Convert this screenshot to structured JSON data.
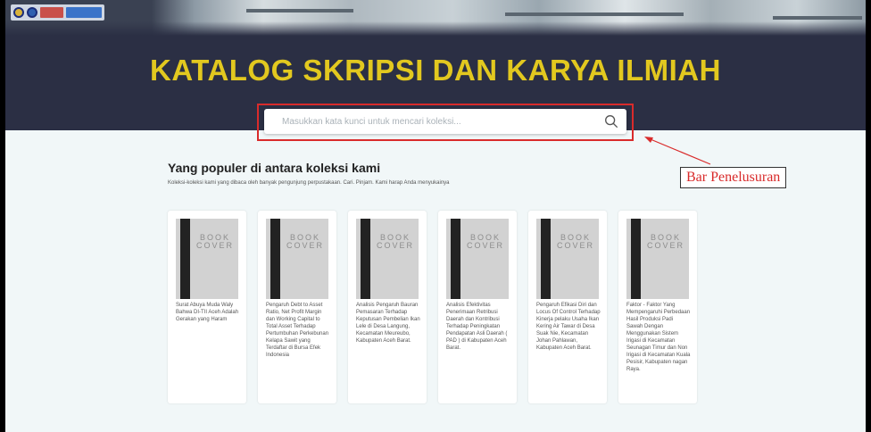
{
  "header": {
    "title": "KATALOG SKRIPSI DAN KARYA ILMIAH"
  },
  "search": {
    "placeholder": "Masukkan kata kunci untuk mencari koleksi...",
    "value": ""
  },
  "annotation": {
    "label": "Bar Penelusuran",
    "color": "#d92b2b"
  },
  "popular": {
    "heading": "Yang populer di antara koleksi kami",
    "subtitle": "Koleksi-koleksi kami yang dibaca oleh banyak pengunjung perpustakaan. Cari. Pinjam. Kami harap Anda menyukainya",
    "cover_text": "BOOK COVER",
    "items": [
      {
        "title": "Surat Abuya Muda Waly Bahwa DI-TII Aceh Adalah Gerakan yang Haram"
      },
      {
        "title": "Pengaruh Debt to Asset Ratio, Net Profit Margin dan Working Capital to Total Asset Terhadap Pertumbuhan Perkebunan Kelapa Sawit yang Terdaftar di Bursa Efek Indonesia"
      },
      {
        "title": "Analisis Pengaruh Bauran Pemasaran Terhadap Keputusan Pembelian Ikan Lele di Desa Langung, Kecamatan Meureubo, Kabupaten Aceh Barat."
      },
      {
        "title": "Analisis Efektivitas Penerimaan Retribusi Daerah dan Kontribusi Terhadap Peningkatan Pendapatan Asli Daerah ( PAD ) di Kabupaten Aceh Barat."
      },
      {
        "title": "Pengaruh Efikasi Diri dan Locus Of Control Terhadap Kinerja pelaku Usaha Ikan Kering Air Tawar di Desa Suak Nie, Kecamatan Johan Pahlawan, Kabupaten Aceh Barat."
      },
      {
        "title": "Faktor - Faktor Yang Mempengaruhi Perbedaan Hasil Produksi Padi Sawah Dengan Menggunakan Sistem Irigasi di Kecamatan Seunagan Timur dan Non Irigasi di Kecamatan Kuala Pesisir, Kabupaten nagan Raya."
      }
    ]
  },
  "colors": {
    "hero_background": "#2b2f44",
    "title_color": "#e2c81f",
    "page_background": "#f1f7f8"
  },
  "icons": {
    "search": "search-icon",
    "logo": "institution-logo-icon"
  }
}
